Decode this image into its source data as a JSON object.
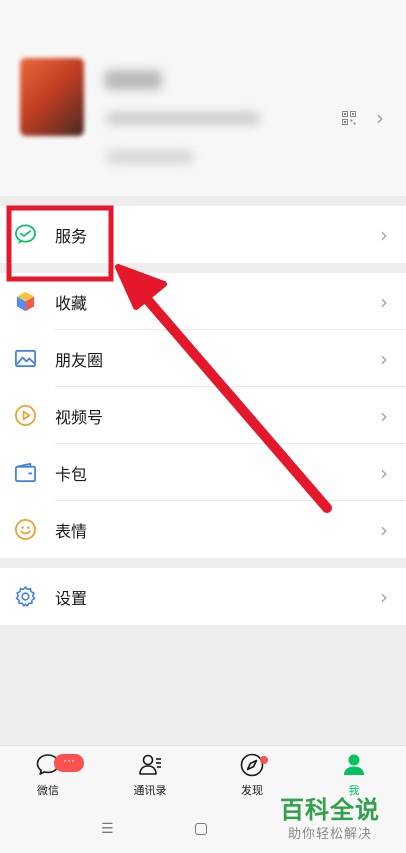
{
  "profile": {
    "qr_icon": "qr-code-icon",
    "chevron": "›"
  },
  "service_group": {
    "items": [
      {
        "label": "服务",
        "icon": "service-wallet-icon"
      }
    ]
  },
  "main_group": {
    "items": [
      {
        "label": "收藏",
        "icon": "favorites-cube-icon"
      },
      {
        "label": "朋友圈",
        "icon": "moments-photo-icon"
      },
      {
        "label": "视频号",
        "icon": "channels-play-icon"
      },
      {
        "label": "卡包",
        "icon": "card-wallet-icon"
      },
      {
        "label": "表情",
        "icon": "sticker-smile-icon"
      }
    ]
  },
  "settings_group": {
    "items": [
      {
        "label": "设置",
        "icon": "gear-icon"
      }
    ]
  },
  "chevron": "›",
  "tabbar": {
    "tabs": [
      {
        "label": "微信",
        "icon": "chat-bubble-icon",
        "badge": "···"
      },
      {
        "label": "通讯录",
        "icon": "contacts-icon"
      },
      {
        "label": "发现",
        "icon": "compass-icon"
      },
      {
        "label": "我",
        "icon": "me-person-icon"
      }
    ]
  },
  "system_nav": {
    "menu": "☰"
  },
  "watermark": {
    "title": "百科全说",
    "subtitle": "助你轻松解决"
  },
  "colors": {
    "accent_green": "#07c160",
    "badge_red": "#fa5151",
    "annotation_red": "#e5172b"
  }
}
